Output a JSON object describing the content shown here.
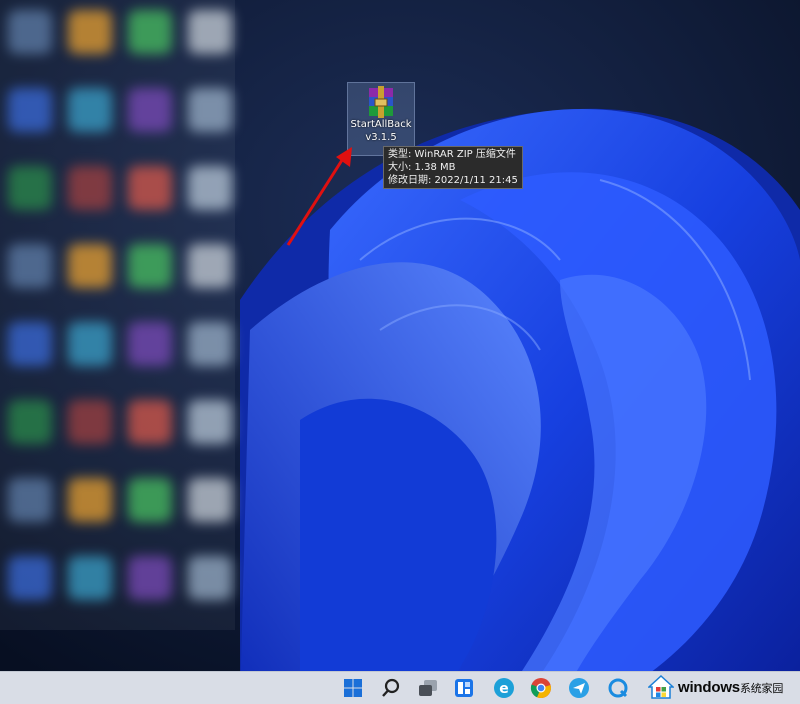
{
  "desktop": {
    "file_icon": {
      "icon": "winrar-archive-icon",
      "name_line1": "StartAllBack",
      "name_line2": "v3.1.5"
    },
    "tooltip": {
      "type_line": "类型: WinRAR ZIP 压缩文件",
      "size_line": "大小: 1.38 MB",
      "date_line": "修改日期: 2022/1/11 21:45"
    }
  },
  "taskbar": {
    "items": [
      {
        "icon": "windows-start-icon"
      },
      {
        "icon": "search-icon"
      },
      {
        "icon": "task-view-icon"
      },
      {
        "icon": "widgets-icon"
      },
      {
        "icon": "edge-legacy-icon"
      },
      {
        "icon": "chrome-icon"
      },
      {
        "icon": "paper-plane-app-icon"
      },
      {
        "icon": "quick-app-icon"
      }
    ]
  },
  "watermark": {
    "brand": "windows",
    "suffix": "系统家园",
    "logo": "windows-house-logo-icon"
  },
  "colors": {
    "annotation_arrow": "#e01010",
    "wallpaper_dark": "#0b1630",
    "wallpaper_blue": "#1d47e6",
    "taskbar": "#d9dde6"
  }
}
